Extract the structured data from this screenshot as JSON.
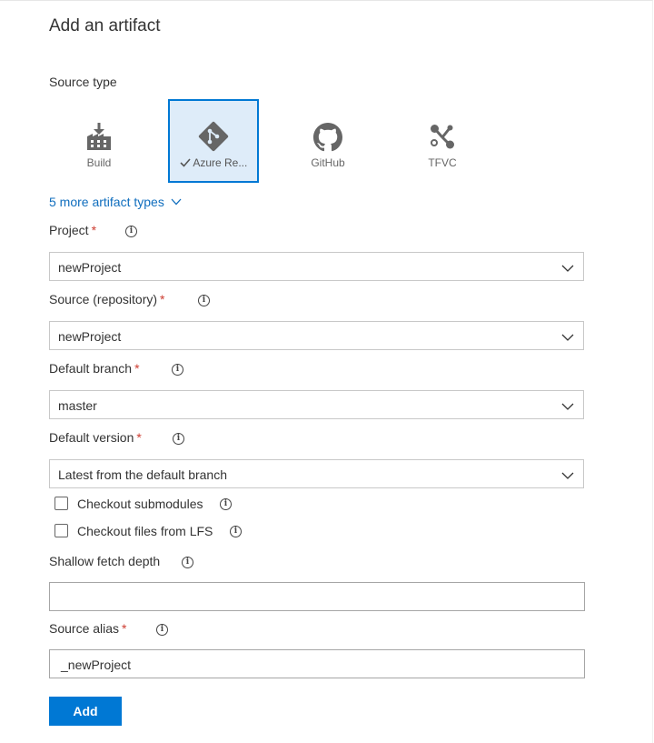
{
  "title": "Add an artifact",
  "source_type": {
    "label": "Source type",
    "tiles": [
      {
        "label": "Build",
        "icon": "build-icon",
        "selected": false
      },
      {
        "label": "Azure Re...",
        "icon": "azure-repos-icon",
        "selected": true
      },
      {
        "label": "GitHub",
        "icon": "github-icon",
        "selected": false
      },
      {
        "label": "TFVC",
        "icon": "tfvc-icon",
        "selected": false
      }
    ],
    "more_link": "5 more artifact types"
  },
  "fields": {
    "project": {
      "label": "Project",
      "required": "*",
      "value": "newProject"
    },
    "source": {
      "label": "Source (repository)",
      "required": "*",
      "value": "newProject"
    },
    "branch": {
      "label": "Default branch",
      "required": "*",
      "value": "master"
    },
    "version": {
      "label": "Default version",
      "required": "*",
      "value": "Latest from the default branch"
    },
    "checkout_submodules": {
      "label": "Checkout submodules",
      "checked": false
    },
    "checkout_lfs": {
      "label": "Checkout files from LFS",
      "checked": false
    },
    "shallow_fetch": {
      "label": "Shallow fetch depth",
      "value": ""
    },
    "alias": {
      "label": "Source alias",
      "required": "*",
      "value": "_newProject"
    }
  },
  "add_button": "Add",
  "colors": {
    "accent": "#0078d4",
    "selected_bg": "#deecf9",
    "required": "#cd3c30",
    "link": "#106ebe"
  }
}
